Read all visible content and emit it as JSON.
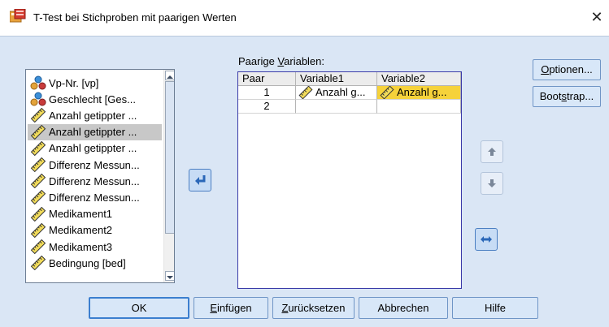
{
  "window": {
    "title": "T-Test bei Stichproben mit paarigen Werten",
    "close_glyph": "✕"
  },
  "source_list": {
    "items": [
      {
        "label": "Vp-Nr. [vp]",
        "icon": "nominal-icon"
      },
      {
        "label": "Geschlecht [Ges...",
        "icon": "nominal-icon"
      },
      {
        "label": "Anzahl getippter ...",
        "icon": "ruler-icon"
      },
      {
        "label": "Anzahl getippter ...",
        "icon": "ruler-icon",
        "selected": true
      },
      {
        "label": "Anzahl getippter ...",
        "icon": "ruler-icon"
      },
      {
        "label": "Differenz Messun...",
        "icon": "ruler-icon"
      },
      {
        "label": "Differenz Messun...",
        "icon": "ruler-icon"
      },
      {
        "label": "Differenz Messun...",
        "icon": "ruler-icon"
      },
      {
        "label": "Medikament1",
        "icon": "ruler-icon"
      },
      {
        "label": "Medikament2",
        "icon": "ruler-icon"
      },
      {
        "label": "Medikament3",
        "icon": "ruler-icon"
      },
      {
        "label": "Bedingung [bed]",
        "icon": "ruler-icon"
      }
    ]
  },
  "paired": {
    "label_pre": "Paarige ",
    "label_u": "V",
    "label_post": "ariablen:",
    "headers": [
      "Paar",
      "Variable1",
      "Variable2"
    ],
    "rows": [
      {
        "paar": "1",
        "var1": "Anzahl g...",
        "var2": "Anzahl g..."
      },
      {
        "paar": "2",
        "var1": "",
        "var2": ""
      }
    ]
  },
  "side_buttons": {
    "optionen": {
      "u": "O",
      "rest": "ptionen..."
    },
    "bootstrap": {
      "pre": "Boot",
      "u": "s",
      "rest": "trap..."
    }
  },
  "buttons": {
    "ok": "OK",
    "einfuegen": {
      "u": "E",
      "rest": "infügen"
    },
    "zuruecksetzen": {
      "u": "Z",
      "rest": "urücksetzen"
    },
    "abbrechen": "Abbrechen",
    "hilfe": "Hilfe"
  },
  "colors": {
    "accent": "#3c7fcf",
    "selection_yellow": "#f6d23a"
  }
}
